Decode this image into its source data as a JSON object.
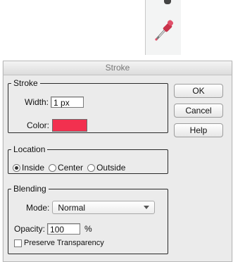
{
  "dialog": {
    "title": "Stroke",
    "buttons": {
      "ok": "OK",
      "cancel": "Cancel",
      "help": "Help"
    }
  },
  "stroke": {
    "legend": "Stroke",
    "width_label": "Width:",
    "width_value": "1 px",
    "color_label": "Color:",
    "color_value": "#f2304f"
  },
  "location": {
    "legend": "Location",
    "options": [
      "Inside",
      "Center",
      "Outside"
    ],
    "selected": "Inside"
  },
  "blending": {
    "legend": "Blending",
    "mode_label": "Mode:",
    "mode_value": "Normal",
    "opacity_label": "Opacity:",
    "opacity_value": "100",
    "opacity_unit": "%",
    "preserve_label": "Preserve Transparency",
    "preserve_checked": false
  },
  "icons": {
    "tool": "eyedropper-icon"
  }
}
